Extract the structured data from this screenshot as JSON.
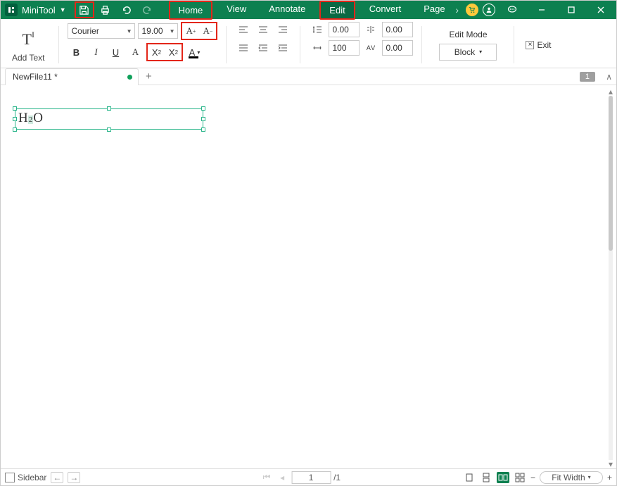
{
  "app": {
    "name": "MiniTool"
  },
  "menus": {
    "home": "Home",
    "view": "View",
    "annotate": "Annotate",
    "edit": "Edit",
    "convert": "Convert",
    "page": "Page"
  },
  "ribbon": {
    "add_text": "Add Text",
    "font_family": "Courier",
    "font_size": "19.00",
    "align_vals": {
      "line_spacing": "0.00",
      "char_spacing": "0.00",
      "indent": "100",
      "word_spacing": "0.00"
    },
    "edit_mode_label": "Edit Mode",
    "block_label": "Block",
    "exit_label": "Exit"
  },
  "tab": {
    "name": "NewFile11 *"
  },
  "page_indicator": "1",
  "textbox": {
    "main": "H",
    "sub": "2",
    "rest": "O"
  },
  "status": {
    "sidebar": "Sidebar",
    "page_current": "1",
    "page_total": "/1",
    "zoom_label": "Fit Width"
  }
}
